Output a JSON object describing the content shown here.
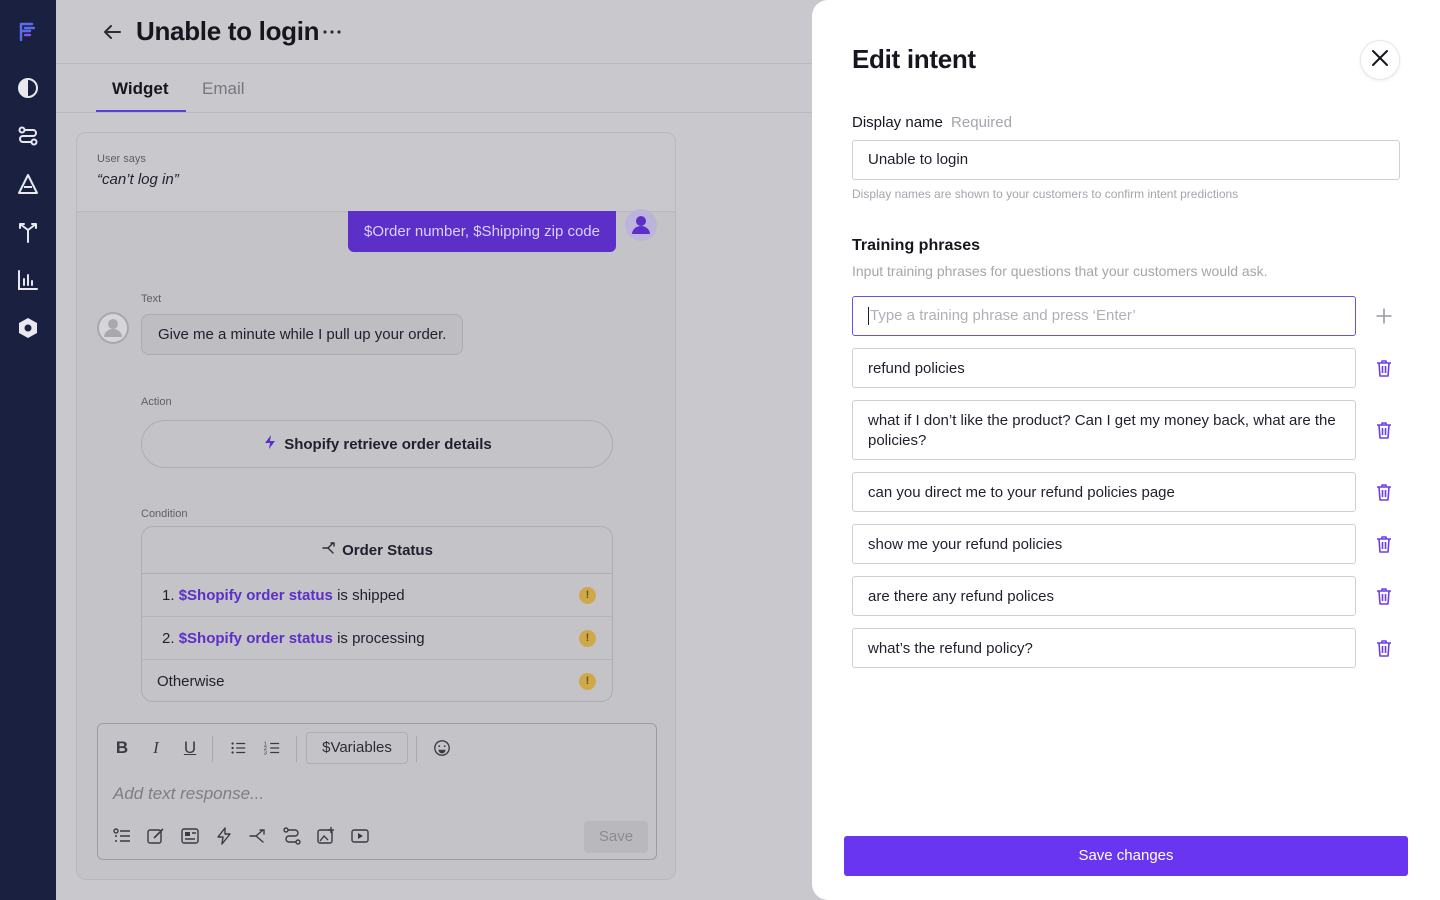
{
  "sidebar": {
    "items": [
      {
        "icon": "logo-icon"
      },
      {
        "icon": "half-circle-icon"
      },
      {
        "icon": "flow-icon"
      },
      {
        "icon": "triangle-icon"
      },
      {
        "icon": "split-arrows-icon"
      },
      {
        "icon": "bar-chart-icon"
      },
      {
        "icon": "hexagon-settings-icon"
      }
    ]
  },
  "header": {
    "title": "Unable to login"
  },
  "tabs": [
    {
      "label": "Widget",
      "active": true
    },
    {
      "label": "Email",
      "active": false
    }
  ],
  "conversation": {
    "user_says_label": "User says",
    "user_says_text": "“can’t log in”",
    "user_bubble": "$Order number, $Shipping zip code",
    "text_label": "Text",
    "bot_text": "Give me a minute while I pull up your order.",
    "action_label": "Action",
    "action_text": "Shopify retrieve order details",
    "condition_label": "Condition",
    "condition_title": "Order Status",
    "conditions": [
      {
        "num": "1.",
        "variable": "$Shopify order status",
        "rest": "is shipped",
        "warning": "!"
      },
      {
        "num": "2.",
        "variable": "$Shopify order status",
        "rest": "is processing",
        "warning": "!"
      },
      {
        "num": "",
        "variable": "",
        "rest": "Otherwise",
        "warning": "!"
      }
    ]
  },
  "editor": {
    "variables_button": "$Variables",
    "placeholder": "Add text response...",
    "save_label": "Save"
  },
  "drawer": {
    "title": "Edit intent",
    "display_name_label": "Display name",
    "required_label": "Required",
    "display_name_value": "Unable to login",
    "display_name_help": "Display names are shown to your customers to confirm intent predictions",
    "training_title": "Training phrases",
    "training_subtitle": "Input training phrases for questions that your customers would ask.",
    "new_phrase_placeholder": "Type a training phrase and press ‘Enter’",
    "phrases": [
      "refund policies",
      "what if I don’t like the product? Can I get my money back, what are the policies?",
      "can you direct me to your refund policies page",
      "show me your refund policies",
      "are there any refund polices",
      "what’s the refund policy?"
    ],
    "save_label": "Save changes"
  },
  "colors": {
    "accent": "#6a35f0",
    "sidebar": "#1a2140",
    "variable": "#5b2fc8",
    "trash": "#6d3fe8"
  }
}
